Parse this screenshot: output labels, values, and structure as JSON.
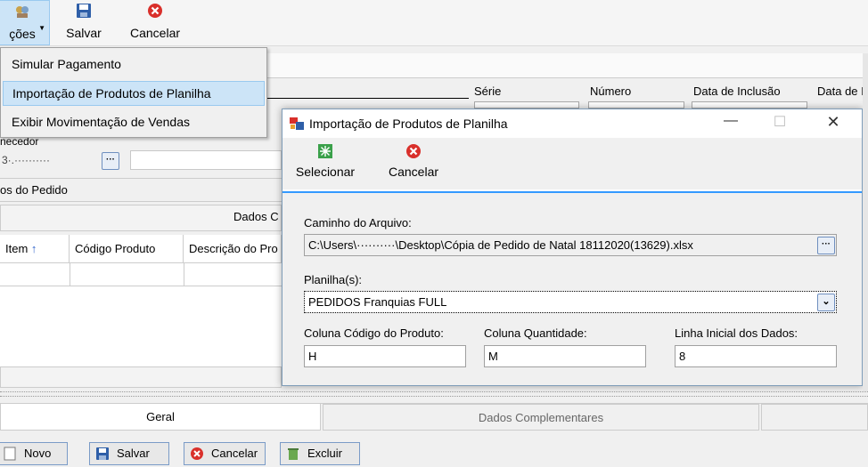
{
  "toolbar": {
    "options_label": "ções",
    "save_label": "Salvar",
    "cancel_label": "Cancelar"
  },
  "menu": {
    "items": [
      {
        "label": "Simular Pagamento"
      },
      {
        "label": "Importação de Produtos de Planilha"
      },
      {
        "label": "Exibir Movimentação de Vendas"
      }
    ]
  },
  "main_form": {
    "fornecedor_label": "necedor",
    "fornecedor_value": "3·.··········",
    "serie_label": "Série",
    "numero_label": "Número",
    "data_inclusao_label": "Data de Inclusão",
    "data_other_label": "Data de I",
    "pedido_section": "os do Pedido",
    "dados_section": "Dados C",
    "grid_columns": [
      "Item",
      "Código Produto",
      "Descrição do Pro"
    ]
  },
  "dialog": {
    "title": "Importação de Produtos de Planilha",
    "select_label": "Selecionar",
    "cancel_label": "Cancelar",
    "file_path_label": "Caminho do Arquivo:",
    "file_path_value": "C:\\Users\\··········\\Desktop\\Cópia de Pedido de Natal 18112020(13629).xlsx",
    "sheets_label": "Planilha(s):",
    "sheet_value": "PEDIDOS Franquias FULL",
    "product_col_label": "Coluna Código do Produto:",
    "product_col_value": "H",
    "qty_col_label": "Coluna Quantidade:",
    "qty_col_value": "M",
    "start_row_label": "Linha Inicial dos Dados:",
    "start_row_value": "8"
  },
  "tabs": [
    {
      "label": "Geral"
    },
    {
      "label": "Dados Complementares"
    }
  ],
  "bottom_buttons": {
    "new_label": "Novo",
    "save_label": "Salvar",
    "cancel_label": "Cancelar",
    "delete_label": "Excluir"
  },
  "colors": {
    "accent": "#3399ff",
    "cancel_red": "#d9302b",
    "menu_highlight": "#cce4f7"
  }
}
